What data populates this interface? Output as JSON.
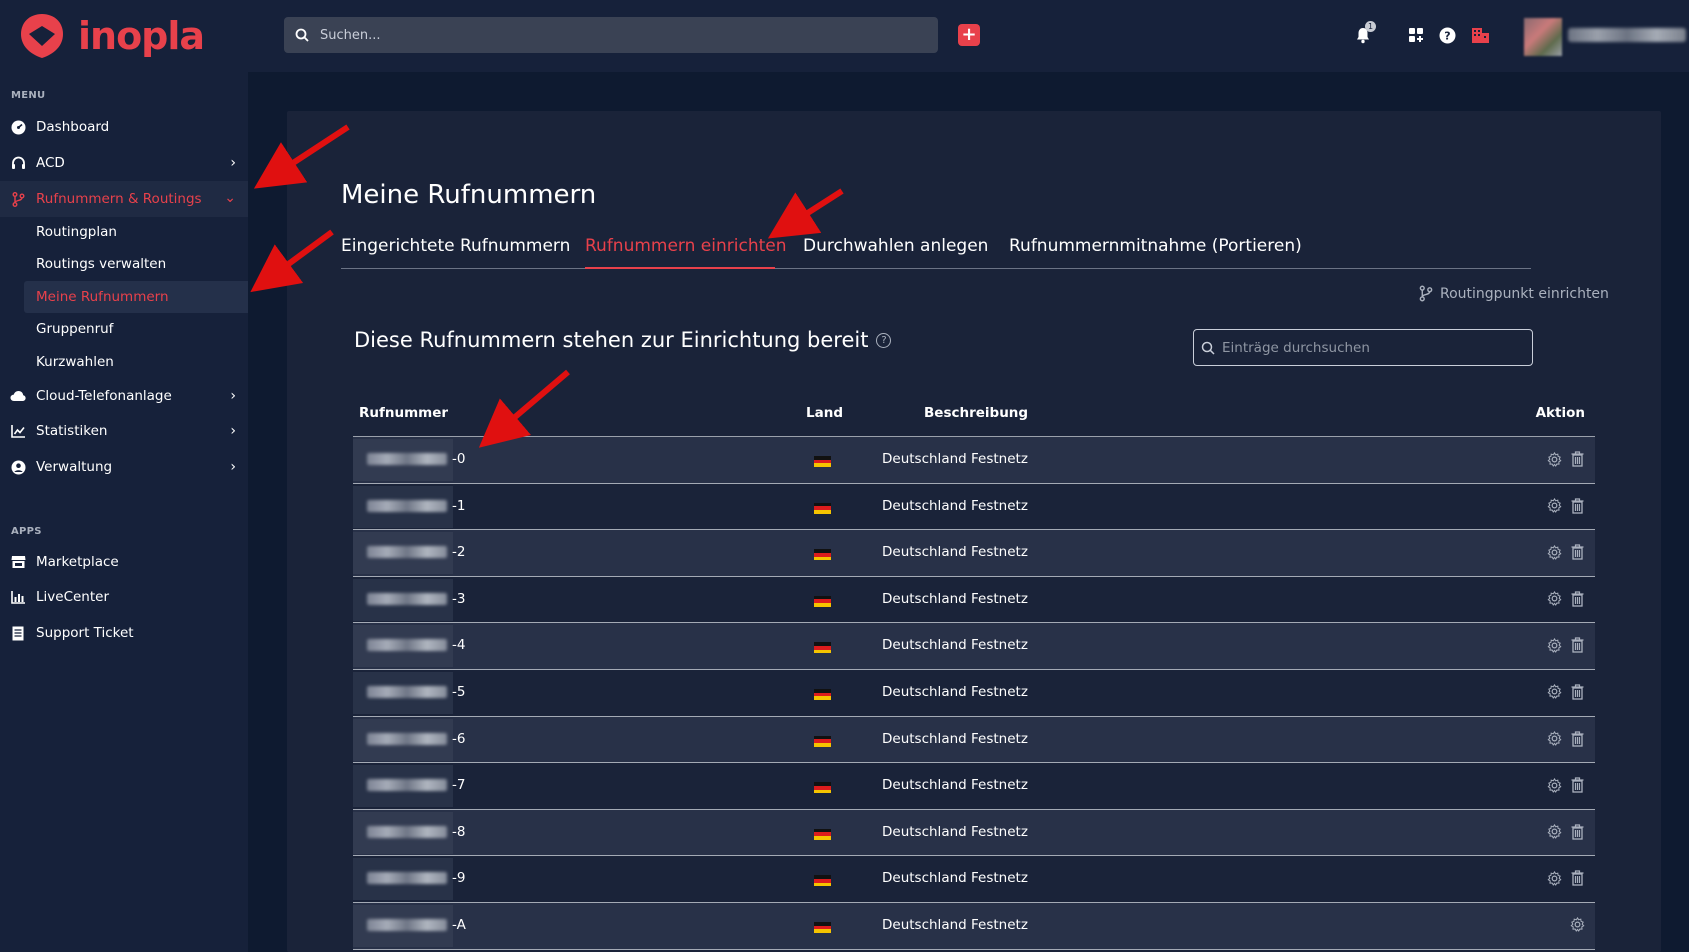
{
  "brand": {
    "name": "inopla",
    "accent": "#e8414b"
  },
  "topbar": {
    "search_placeholder": "Suchen...",
    "add_label": "+",
    "notification_count": "1",
    "icons": [
      "plus-icon",
      "bell-icon",
      "apps-icon",
      "help-icon",
      "building-icon"
    ]
  },
  "sidebar": {
    "menu_label": "MENU",
    "items": [
      {
        "label": "Dashboard",
        "icon": "dashboard-icon"
      },
      {
        "label": "ACD",
        "icon": "headset-icon"
      },
      {
        "label": "Rufnummern & Routings",
        "icon": "branch-icon"
      },
      {
        "label": "Cloud-Telefonanlage",
        "icon": "cloud-icon"
      },
      {
        "label": "Statistiken",
        "icon": "chart-icon"
      },
      {
        "label": "Verwaltung",
        "icon": "user-circle-icon"
      }
    ],
    "subitems": [
      {
        "label": "Routingplan"
      },
      {
        "label": "Routings verwalten"
      },
      {
        "label": "Meine Rufnummern"
      },
      {
        "label": "Gruppenruf"
      },
      {
        "label": "Kurzwahlen"
      }
    ],
    "apps_label": "APPS",
    "apps": [
      {
        "label": "Marketplace",
        "icon": "store-icon"
      },
      {
        "label": "LiveCenter",
        "icon": "bar-chart-icon"
      },
      {
        "label": "Support Ticket",
        "icon": "ticket-icon"
      }
    ]
  },
  "main": {
    "title": "Meine Rufnummern",
    "tabs": [
      {
        "label": "Eingerichtete Rufnummern"
      },
      {
        "label": "Rufnummern einrichten"
      },
      {
        "label": "Durchwahlen anlegen"
      },
      {
        "label": "Rufnummernmitnahme (Portieren)"
      }
    ],
    "active_tab": "Rufnummern einrichten",
    "routing_link": "Routingpunkt einrichten",
    "section_title": "Diese Rufnummern stehen zur Einrichtung bereit",
    "entries_search_placeholder": "Einträge durchsuchen",
    "table": {
      "headers": {
        "number": "Rufnummer",
        "country": "Land",
        "description": "Beschreibung",
        "action": "Aktion"
      },
      "rows": [
        {
          "suffix": "-0",
          "country": "DE",
          "description": "Deutschland Festnetz"
        },
        {
          "suffix": "-1",
          "country": "DE",
          "description": "Deutschland Festnetz"
        },
        {
          "suffix": "-2",
          "country": "DE",
          "description": "Deutschland Festnetz"
        },
        {
          "suffix": "-3",
          "country": "DE",
          "description": "Deutschland Festnetz"
        },
        {
          "suffix": "-4",
          "country": "DE",
          "description": "Deutschland Festnetz"
        },
        {
          "suffix": "-5",
          "country": "DE",
          "description": "Deutschland Festnetz"
        },
        {
          "suffix": "-6",
          "country": "DE",
          "description": "Deutschland Festnetz"
        },
        {
          "suffix": "-7",
          "country": "DE",
          "description": "Deutschland Festnetz"
        },
        {
          "suffix": "-8",
          "country": "DE",
          "description": "Deutschland Festnetz"
        },
        {
          "suffix": "-9",
          "country": "DE",
          "description": "Deutschland Festnetz"
        },
        {
          "suffix": "-A",
          "country": "DE",
          "description": "Deutschland Festnetz"
        }
      ]
    }
  }
}
